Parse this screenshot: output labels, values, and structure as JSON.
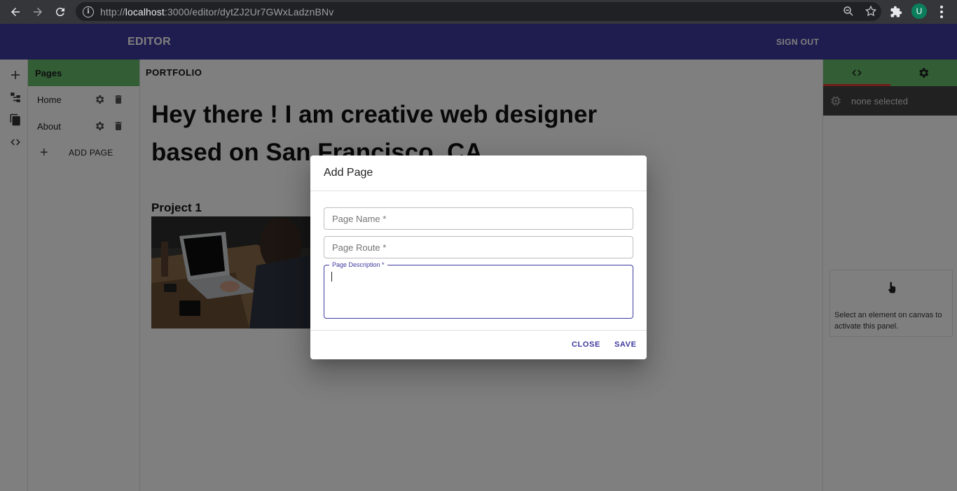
{
  "browser": {
    "url_prefix": "http://",
    "url_host": "localhost",
    "url_rest": ":3000/editor/dytZJ2Ur7GWxLadznBNv",
    "profile_initial": "U"
  },
  "appbar": {
    "title": "EDITOR",
    "signout_label": "SIGN OUT",
    "color": "#3f3a9e"
  },
  "pages_panel": {
    "heading": "Pages",
    "items": [
      {
        "label": "Home"
      },
      {
        "label": "About"
      }
    ],
    "add_label": "ADD PAGE",
    "accent": "#66bb6a"
  },
  "canvas": {
    "brand": "PORTFOLIO",
    "hero_line1": "Hey there ! I am creative web designer",
    "hero_line2": "based on San Francisco, CA",
    "project_title": "Project 1"
  },
  "right_panel": {
    "selection_text": "none selected",
    "hint_text": "Select an element on canvas to activate this panel."
  },
  "dialog": {
    "title": "Add Page",
    "page_name_placeholder": "Page Name *",
    "page_route_placeholder": "Page Route *",
    "page_description_label": "Page Description *",
    "close_label": "CLOSE",
    "save_label": "SAVE"
  }
}
